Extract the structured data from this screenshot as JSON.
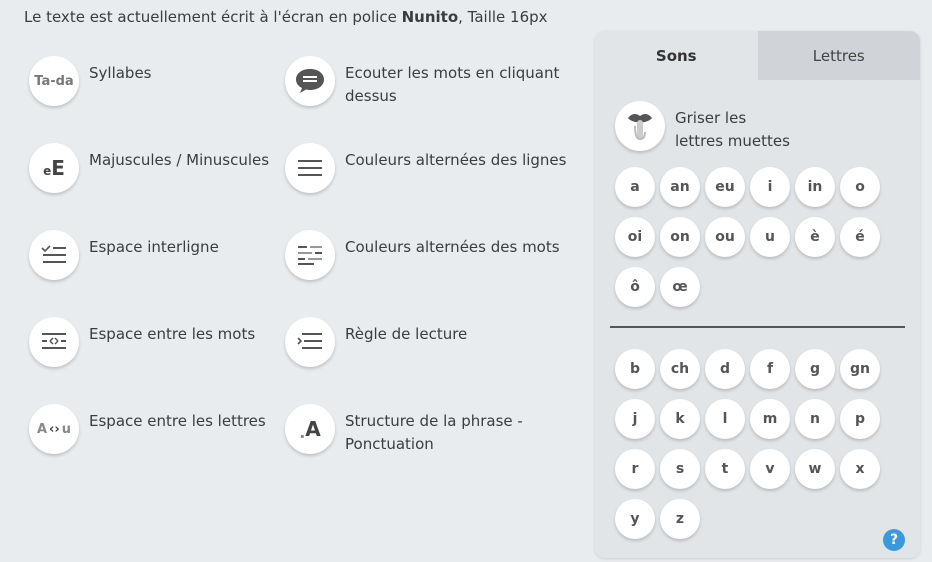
{
  "header": {
    "prefix": "Le texte est actuellement écrit à l'écran en police ",
    "font_name": "Nunito",
    "suffix": ", Taille 16px"
  },
  "tools": {
    "syllabes": {
      "label": "Syllabes",
      "icon": "syllable-icon",
      "icon_text": "Ta-da"
    },
    "ecouter": {
      "label": "Ecouter les mots en cliquant dessus",
      "icon": "speech-bubble-icon"
    },
    "majuscules": {
      "label": "Majuscules / Minuscules",
      "icon": "case-icon",
      "icon_small": "e",
      "icon_big": "E"
    },
    "couleurs_lignes": {
      "label": "Couleurs alternées des lignes",
      "icon": "lines-icon"
    },
    "interligne": {
      "label": "Espace interligne",
      "icon": "line-spacing-icon"
    },
    "couleurs_mots": {
      "label": "Couleurs alternées des mots",
      "icon": "word-colors-icon"
    },
    "espace_mots": {
      "label": "Espace entre les mots",
      "icon": "word-spacing-icon"
    },
    "regle": {
      "label": "Règle de lecture",
      "icon": "reading-ruler-icon"
    },
    "espace_lettres": {
      "label": "Espace entre les lettres",
      "icon": "letter-spacing-icon",
      "icon_text_a": "A",
      "icon_text_u": "u",
      "icon_arrows": "‹›"
    },
    "structure": {
      "label": "Structure de la phrase - Ponctuation",
      "icon": "punctuation-icon",
      "icon_dot": ".",
      "icon_letter": "A"
    }
  },
  "panel": {
    "tabs": [
      {
        "label": "Sons",
        "active": true
      },
      {
        "label": "Lettres",
        "active": false
      }
    ],
    "mute_label": "Griser les lettres muettes",
    "vowel_sounds": [
      "a",
      "an",
      "eu",
      "i",
      "in",
      "o",
      "oi",
      "on",
      "ou",
      "u",
      "è",
      "é",
      "ô",
      "œ"
    ],
    "consonant_sounds": [
      "b",
      "ch",
      "d",
      "f",
      "g",
      "gn",
      "j",
      "k",
      "l",
      "m",
      "n",
      "p",
      "r",
      "s",
      "t",
      "v",
      "w",
      "x",
      "y",
      "z"
    ],
    "help_label": "?"
  },
  "colors": {
    "background": "#e9ecef",
    "panel": "#e2e5e8",
    "inactive_tab": "#d0d4d8",
    "help_blue": "#3a9ad9"
  }
}
